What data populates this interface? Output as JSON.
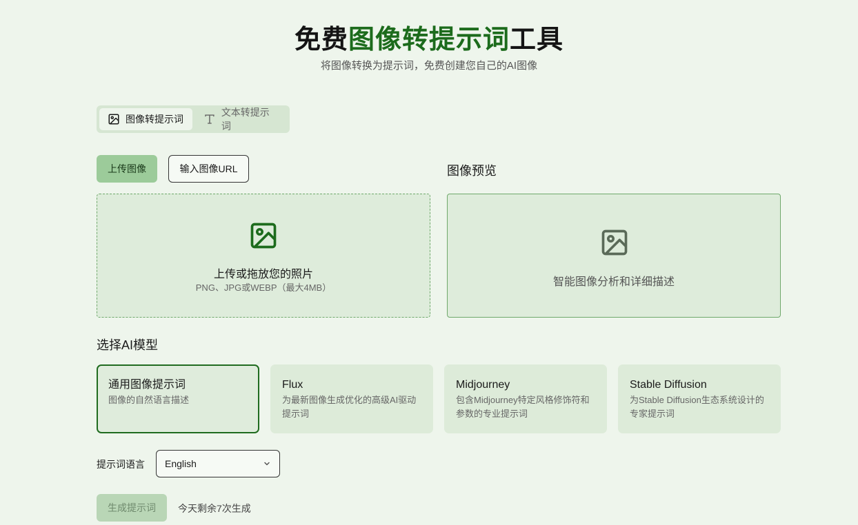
{
  "header": {
    "title_prefix": "免费",
    "title_highlight": "图像转提示词",
    "title_suffix": "工具",
    "subtitle": "将图像转换为提示词，免费创建您自己的AI图像"
  },
  "mode_tabs": [
    {
      "label": "图像转提示词",
      "icon": "image-icon",
      "active": true
    },
    {
      "label": "文本转提示词",
      "icon": "text-icon",
      "active": false
    }
  ],
  "upload": {
    "upload_button": "上传图像",
    "url_button": "输入图像URL",
    "drop_main": "上传或拖放您的照片",
    "drop_hint": "PNG、JPG或WEBP（最大4MB）"
  },
  "preview": {
    "title": "图像预览",
    "description": "智能图像分析和详细描述"
  },
  "models": {
    "title": "选择AI模型",
    "items": [
      {
        "name": "通用图像提示词",
        "desc": "图像的自然语言描述",
        "selected": true
      },
      {
        "name": "Flux",
        "desc": "为最新图像生成优化的高级AI驱动提示词",
        "selected": false
      },
      {
        "name": "Midjourney",
        "desc": "包含Midjourney特定风格修饰符和参数的专业提示词",
        "selected": false
      },
      {
        "name": "Stable Diffusion",
        "desc": "为Stable Diffusion生态系统设计的专家提示词",
        "selected": false
      }
    ]
  },
  "language": {
    "label": "提示词语言",
    "selected": "English"
  },
  "generate": {
    "button": "生成提示词",
    "remaining": "今天剩余7次生成"
  },
  "colors": {
    "accent": "#1c6b1c",
    "background": "#eef5ec",
    "panel": "#deecdb"
  }
}
